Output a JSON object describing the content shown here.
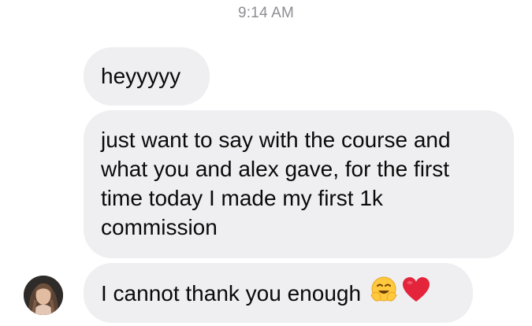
{
  "header": {
    "timestamp": "9:14 AM"
  },
  "messages": [
    {
      "text": "heyyyyy"
    },
    {
      "lines": [
        "just want to say with the course and",
        "what you and alex gave, for the first",
        "time today I made my first 1k",
        "commission"
      ]
    },
    {
      "text": "I cannot thank you enough",
      "emojis": [
        "hugging-face-emoji",
        "red-heart-emoji"
      ]
    }
  ],
  "colors": {
    "bubble": "#efeff1",
    "timestamp": "#8e8e93",
    "heart": "#e3243b",
    "emoji_face": "#ffc83d"
  }
}
